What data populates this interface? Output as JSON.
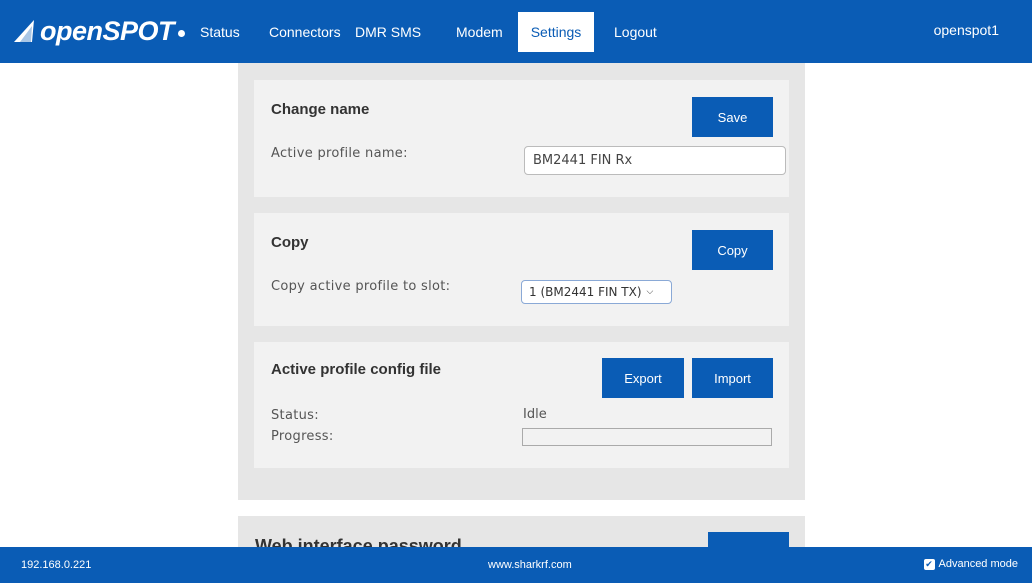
{
  "brand": {
    "name": "openSPOT"
  },
  "nav": {
    "items": [
      {
        "label": "Status"
      },
      {
        "label": "Connectors"
      },
      {
        "label": "DMR SMS"
      },
      {
        "label": "Modem"
      },
      {
        "label": "Settings",
        "active": true
      },
      {
        "label": "Logout"
      }
    ],
    "hostname": "openspot1"
  },
  "change_name": {
    "title": "Change name",
    "save_label": "Save",
    "field_label": "Active profile name:",
    "field_value": "BM2441 FIN Rx"
  },
  "copy": {
    "title": "Copy",
    "button_label": "Copy",
    "field_label": "Copy active profile to slot:",
    "selected_option": "1 (BM2441 FIN TX)"
  },
  "config_file": {
    "title": "Active profile config file",
    "export_label": "Export",
    "import_label": "Import",
    "status_label": "Status:",
    "status_value": "Idle",
    "progress_label": "Progress:",
    "progress_fraction": 0
  },
  "web_password": {
    "title": "Web interface password"
  },
  "footer": {
    "ip": "192.168.0.221",
    "site": "www.sharkrf.com",
    "advanced_mode_label": "Advanced mode",
    "advanced_mode_checked": true
  },
  "colors": {
    "brand_blue": "#0a5cb5",
    "panel_grey": "#e6e6e6",
    "card_grey": "#f2f2f2"
  }
}
